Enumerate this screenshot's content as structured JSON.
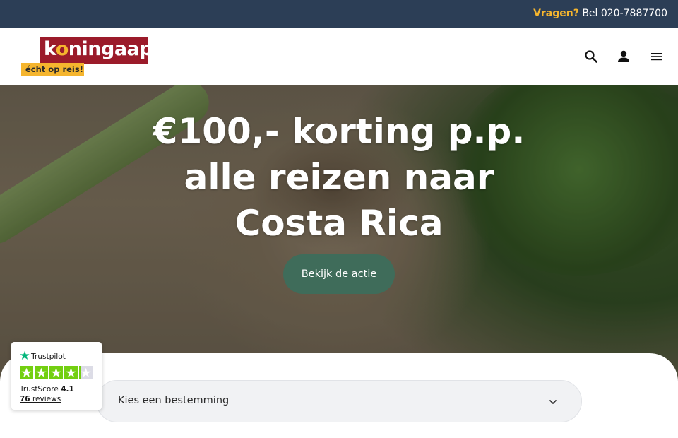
{
  "topbar": {
    "question": "Vragen?",
    "phone_text": "Bel 020-7887700",
    "bg_color": "#2c3e56",
    "accent_color": "#f5b52e"
  },
  "header": {
    "logo": {
      "word_k": "k",
      "word_o": "o",
      "word_rest": "ningaap",
      "tagline": "écht op reis!",
      "brand_color": "#9b1b2a"
    },
    "icons": [
      "search-icon",
      "user-icon",
      "menu-icon"
    ]
  },
  "hero": {
    "title_line1": "€100,- korting p.p.",
    "title_line2": "alle reizen naar",
    "title_line3": "Costa Rica",
    "cta_label": "Bekijk de actie",
    "cta_color": "#3f6c5a"
  },
  "destination_select": {
    "value": "Kies een bestemming",
    "icon": "chevron-down-icon"
  },
  "trustpilot": {
    "brand": "Trustpilot",
    "score_label": "TrustScore",
    "score_value": "4.1",
    "review_count": "76",
    "reviews_label": "reviews",
    "rating_fraction": 0.82,
    "star_color": "#73cf11"
  }
}
